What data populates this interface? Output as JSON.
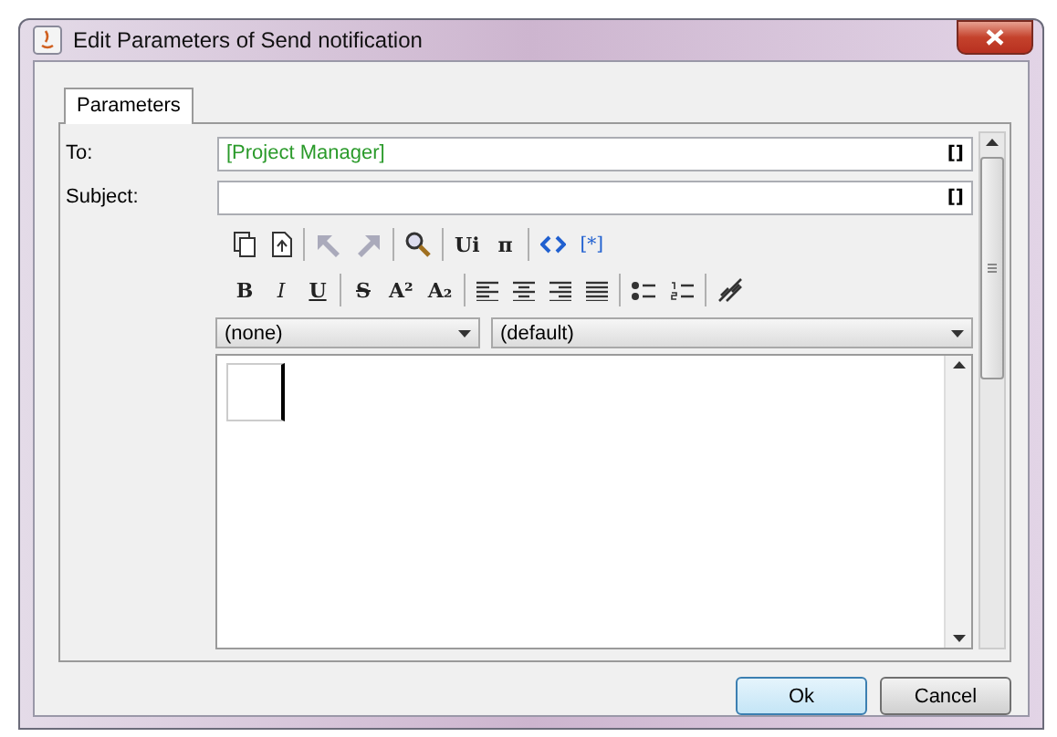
{
  "window": {
    "title": "Edit Parameters of Send notification"
  },
  "tabs": [
    {
      "label": "Parameters",
      "selected": true
    }
  ],
  "fields": [
    {
      "label": "To:",
      "value": "[Project Manager]",
      "insert": "[]"
    },
    {
      "label": "Subject:",
      "insert": "[]"
    }
  ],
  "toolbar_rows": [
    [
      {
        "kind": "copy",
        "disabled": false
      },
      {
        "kind": "paste",
        "disabled": false
      },
      {
        "kind": "separator"
      },
      {
        "kind": "undo",
        "disabled": true
      },
      {
        "kind": "redo",
        "disabled": true
      },
      {
        "kind": "separator"
      },
      {
        "kind": "search",
        "disabled": false
      },
      {
        "kind": "separator"
      },
      {
        "kind": "glyph",
        "text": "Ui",
        "disabled": false
      },
      {
        "kind": "glyph",
        "text": "π",
        "disabled": false
      },
      {
        "kind": "separator"
      },
      {
        "kind": "code",
        "disabled": false
      },
      {
        "kind": "glyph",
        "text": "[*]",
        "disabled": false
      }
    ],
    [
      {
        "kind": "glyph",
        "text": "B",
        "disabled": false
      },
      {
        "kind": "glyph",
        "text": "I",
        "disabled": false
      },
      {
        "kind": "glyph",
        "text": "U",
        "disabled": false
      },
      {
        "kind": "separator"
      },
      {
        "kind": "glyph",
        "text": "S",
        "disabled": false
      },
      {
        "kind": "glyph",
        "text": "A²",
        "disabled": false
      },
      {
        "kind": "glyph",
        "text": "A₂",
        "disabled": false
      },
      {
        "kind": "separator"
      },
      {
        "kind": "align-left",
        "disabled": false
      },
      {
        "kind": "align-center",
        "disabled": false
      },
      {
        "kind": "align-right",
        "disabled": false
      },
      {
        "kind": "justify",
        "disabled": false
      },
      {
        "kind": "separator"
      },
      {
        "kind": "bullets",
        "disabled": false
      },
      {
        "kind": "numbers",
        "disabled": false
      },
      {
        "kind": "separator"
      },
      {
        "kind": "unlink",
        "disabled": false
      }
    ]
  ],
  "dropdowns": [
    {
      "value": "(none)"
    },
    {
      "value": "(default)"
    }
  ],
  "buttons": [
    {
      "label": "Ok",
      "default": true
    },
    {
      "label": "Cancel",
      "default": false
    }
  ]
}
